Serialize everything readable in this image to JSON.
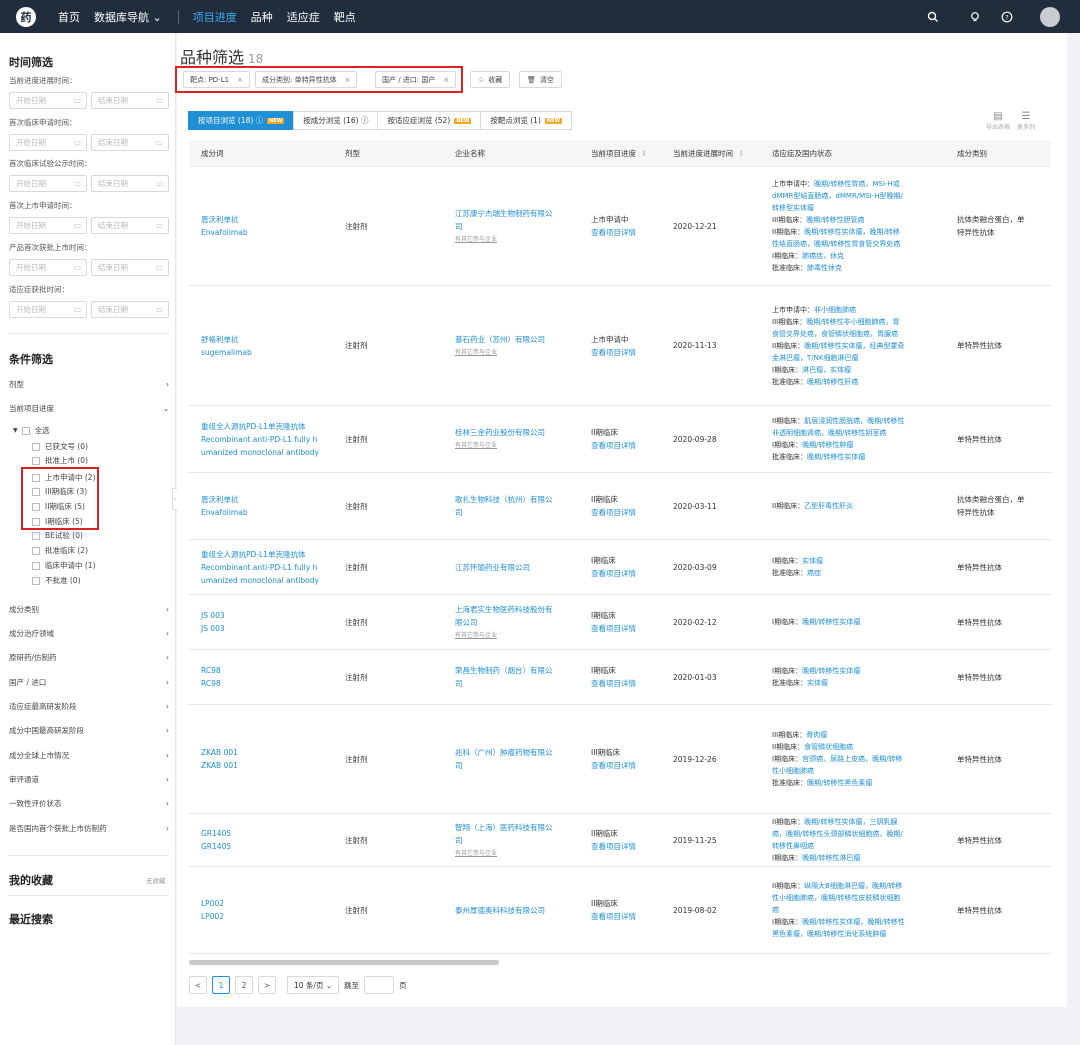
{
  "topbar": {
    "logo": "药",
    "nav": [
      "首页",
      "数据库导航 ⌄"
    ],
    "nav2": [
      "项目进度",
      "品种",
      "适应症",
      "靶点"
    ],
    "icons": [
      "search-icon",
      "bulb-icon",
      "help-icon",
      "avatar"
    ]
  },
  "sidebar": {
    "time_title": "时间筛选",
    "time_fields": [
      "当前进度进展时间：",
      "首次临床申请时间：",
      "首次临床试验公示时间：",
      "首次上市申请时间：",
      "产品首次获批上市时间：",
      "适应症获批时间："
    ],
    "start_ph": "开始日期",
    "end_ph": "结束日期",
    "cond_title": "条件筛选",
    "cond_dosage": "剂型",
    "cond_progress": "当前项目进度",
    "tree_all": "全选",
    "tree_items": [
      "已获文号 (0)",
      "批准上市 (0)",
      "上市申请中 (2)",
      "III期临床 (3)",
      "II期临床 (5)",
      "I期临床 (5)",
      "BE试验 (0)",
      "批准临床 (2)",
      "临床申请中 (1)",
      "不批准 (0)"
    ],
    "filters": [
      "成分类别",
      "成分治疗领域",
      "原研药/仿制药",
      "国产 / 进口",
      "适应症最高研发阶段",
      "成分中国最高研发阶段",
      "成分全球上市情况",
      "审评通道",
      "一致性评价状态",
      "是否国内首个获批上市仿制药"
    ],
    "fav_title": "我的收藏",
    "fav_empty": "无收藏",
    "recent_title": "最近搜索"
  },
  "main": {
    "title": "品种筛选",
    "count": "18",
    "chips": [
      "靶点: PD-L1",
      "成分类别: 单特异性抗体",
      "国产 / 进口: 国产"
    ],
    "fav_btn": "收藏",
    "clear_btn": "清空",
    "tabs": [
      {
        "label": "按项目浏览 (18) ⓘ",
        "new": "NEW"
      },
      {
        "label": "按成分浏览 (16) ⓘ",
        "new": ""
      },
      {
        "label": "按适应症浏览 (52)",
        "new": "NEW"
      },
      {
        "label": "按靶点浏览 (1)",
        "new": "NEW"
      }
    ],
    "export": "导出表格",
    "more_cols": "更多列",
    "headers": [
      "成分词",
      "剂型",
      "企业名称",
      "当前项目进度",
      "当前进度进展时间",
      "适应症及国内状态",
      "成分类别"
    ],
    "detail_link": "查看项目详情",
    "other_link": "有其它参与企业",
    "rows": [
      {
        "name": [
          "恩沃利单抗",
          "Envafolimab"
        ],
        "dosage": "注射剂",
        "company": [
          "江苏康宁杰瑞生物制药有限公",
          "司"
        ],
        "other": true,
        "stage": "上市申请中",
        "date": "2020-12-21",
        "ind": [
          [
            "上市申请中：",
            "晚期/转移性胃癌，MSI-H或"
          ],
          [
            "",
            "dMMR型结直肠癌，dMMR/MSI-H型晚期/"
          ],
          [
            "",
            "转移型实体瘤"
          ],
          [
            "III期临床：",
            "晚期/转移性胆管癌"
          ],
          [
            "II期临床：",
            "晚期/转移性实体瘤，晚期/转移"
          ],
          [
            "",
            "性结直肠癌，晚期/转移性胃食管交界处癌"
          ],
          [
            "I期临床：",
            "肺癌症，休克"
          ],
          [
            "批准临床：",
            "肺毒性休克"
          ]
        ],
        "cat": [
          "抗体类融合蛋白，单",
          "特异性抗体"
        ]
      },
      {
        "name": [
          "舒格利单抗",
          "sugemalimab"
        ],
        "dosage": "注射剂",
        "company": [
          "基石药业（苏州）有限公司"
        ],
        "other": true,
        "stage": "上市申请中",
        "date": "2020-11-13",
        "ind": [
          [
            "上市申请中：",
            "非小细胞肺癌"
          ],
          [
            "III期临床：",
            "晚期/转移性非小细胞肺癌，胃"
          ],
          [
            "",
            "食管交界处癌，食管鳞状细胞癌，胃腺癌"
          ],
          [
            "II期临床：",
            "晚期/转移性实体瘤，经典型霍奇"
          ],
          [
            "",
            "金淋巴瘤，T/NK细胞淋巴瘤"
          ],
          [
            "I期临床：",
            "淋巴瘤，实体瘤"
          ],
          [
            "批准临床：",
            "晚期/转移性肝癌"
          ]
        ],
        "cat": [
          "单特异性抗体"
        ]
      },
      {
        "name": [
          "重组全人源抗PD-L1单克隆抗体",
          "Recombinant anti-PD-L1 fully h",
          "umanized monoclonal antibody"
        ],
        "dosage": "注射剂",
        "company": [
          "桂林三金药业股份有限公司"
        ],
        "other": true,
        "stage": "II期临床",
        "date": "2020-09-28",
        "ind": [
          [
            "II期临床：",
            "肌层浸润性膀胱癌，晚期/转移性"
          ],
          [
            "",
            "非透明细胞肾癌，晚期/转移性阴茎癌"
          ],
          [
            "I期临床：",
            "晚期/转移性肿瘤"
          ],
          [
            "批准临床：",
            "晚期/转移性实体瘤"
          ]
        ],
        "cat": [
          "单特异性抗体"
        ]
      },
      {
        "name": [
          "恩沃利单抗",
          "Envafolimab"
        ],
        "dosage": "注射剂",
        "company": [
          "歌礼生物科技（杭州）有限公",
          "司"
        ],
        "other": false,
        "stage": "II期临床",
        "date": "2020-03-11",
        "ind": [
          [
            "II期临床：",
            "乙型肝毒性肝炎"
          ]
        ],
        "cat": [
          "抗体类融合蛋白，单",
          "特异性抗体"
        ]
      },
      {
        "name": [
          "重组全人源抗PD-L1单克隆抗体",
          "Recombinant anti-PD-L1 fully h",
          "umanized monoclonal antibody"
        ],
        "dosage": "注射剂",
        "company": [
          "江苏怀瑜药业有限公司"
        ],
        "other": false,
        "stage": "I期临床",
        "date": "2020-03-09",
        "ind": [
          [
            "I期临床：",
            "实体瘤"
          ],
          [
            "批准临床：",
            "癌症"
          ]
        ],
        "cat": [
          "单特异性抗体"
        ]
      },
      {
        "name": [
          "JS 003",
          "JS 003"
        ],
        "dosage": "注射剂",
        "company": [
          "上海君实生物医药科技股份有",
          "限公司"
        ],
        "other": true,
        "stage": "I期临床",
        "date": "2020-02-12",
        "ind": [
          [
            "I期临床：",
            "晚期/转移性实体瘤"
          ]
        ],
        "cat": [
          "单特异性抗体"
        ]
      },
      {
        "name": [
          "RC98",
          "RC98"
        ],
        "dosage": "注射剂",
        "company": [
          "荣昌生物制药（烟台）有限公",
          "司"
        ],
        "other": false,
        "stage": "I期临床",
        "date": "2020-01-03",
        "ind": [
          [
            "I期临床：",
            "晚期/转移性实体瘤"
          ],
          [
            "批准临床：",
            "实体瘤"
          ]
        ],
        "cat": [
          "单特异性抗体"
        ]
      },
      {
        "name": [
          "ZKAB 001",
          "ZKAB 001"
        ],
        "dosage": "注射剂",
        "company": [
          "兆科（广州）肿瘤药物有限公",
          "司"
        ],
        "other": false,
        "stage": "III期临床",
        "date": "2019-12-26",
        "ind": [
          [
            "III期临床：",
            "骨肉瘤"
          ],
          [
            "II期临床：",
            "食管鳞状细胞癌"
          ],
          [
            "I期临床：",
            "宫颈癌，尿路上皮癌，晚期/转移"
          ],
          [
            "",
            "性小细胞肺癌"
          ],
          [
            "批准临床：",
            "晚期/转移性黑色素瘤"
          ]
        ],
        "cat": [
          "单特异性抗体"
        ]
      },
      {
        "name": [
          "GR1405",
          "GR1405"
        ],
        "dosage": "注射剂",
        "company": [
          "智翔（上海）医药科技有限公",
          "司"
        ],
        "other": true,
        "stage": "II期临床",
        "date": "2019-11-25",
        "ind": [
          [
            "II期临床：",
            "晚期/转移性实体瘤，三阴乳腺"
          ],
          [
            "",
            "癌，晚期/转移性头颈部鳞状细胞癌，晚期/"
          ],
          [
            "",
            "转移性鼻咽癌"
          ],
          [
            "I期临床：",
            "晚期/转移性淋巴瘤"
          ]
        ],
        "cat": [
          "单特异性抗体"
        ]
      },
      {
        "name": [
          "LP002",
          "LP002"
        ],
        "dosage": "注射剂",
        "company": [
          "泰州厚德奥科科技有限公司"
        ],
        "other": false,
        "stage": "II期临床",
        "date": "2019-08-02",
        "ind": [
          [
            "II期临床：",
            "纵隔大B细胞淋巴瘤，晚期/转移"
          ],
          [
            "",
            "性小细胞肺癌，晚期/转移性皮肤鳞状细胞"
          ],
          [
            "",
            "癌"
          ],
          [
            "I期临床：",
            "晚期/转移性实体瘤，晚期/转移性"
          ],
          [
            "",
            "黑色素瘤，晚期/转移性消化系统肿瘤"
          ]
        ],
        "cat": [
          "单特异性抗体"
        ]
      }
    ],
    "pager": {
      "prev": "<",
      "pages": [
        "1",
        "2"
      ],
      "next": ">",
      "size": "10 条/页 ⌄",
      "jump": "跳至",
      "page_unit": "页"
    }
  }
}
